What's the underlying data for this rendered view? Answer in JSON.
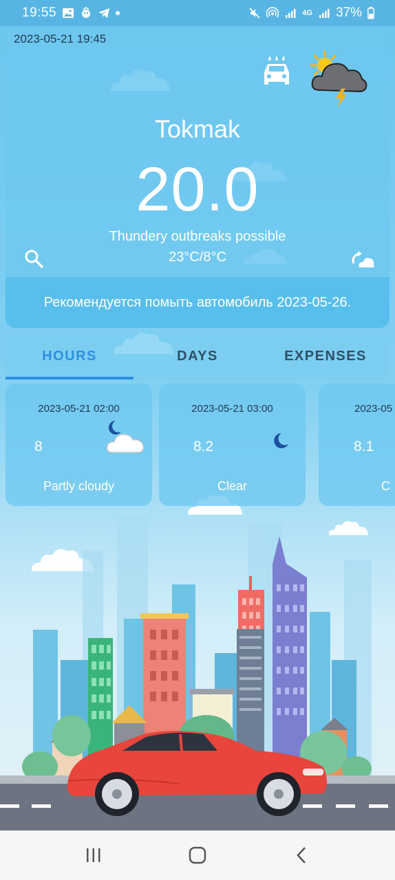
{
  "status_bar": {
    "time": "19:55",
    "network": "4G",
    "battery": "37%"
  },
  "main": {
    "timestamp": "2023-05-21 19:45",
    "city": "Tokmak",
    "temperature": "20.0",
    "condition": "Thundery outbreaks possible",
    "minmax": "23°C/8°C",
    "recommendation": "Рекомендуется помыть автомобиль 2023-05-26.",
    "weather_icon": "thunder-cloud-sun-icon",
    "car_wash_icon": "car-wash-icon"
  },
  "tabs": [
    {
      "label": "HOURS",
      "active": true
    },
    {
      "label": "DAYS",
      "active": false
    },
    {
      "label": "EXPENSES",
      "active": false
    }
  ],
  "hours": [
    {
      "time": "2023-05-21 02:00",
      "temp": "8",
      "desc": "Partly cloudy",
      "icon": "moon-cloud-icon"
    },
    {
      "time": "2023-05-21 03:00",
      "temp": "8.2",
      "desc": "Clear",
      "icon": "moon-icon"
    },
    {
      "time": "2023-05",
      "temp": "8.1",
      "desc": "C",
      "icon": "moon-icon"
    }
  ],
  "colors": {
    "accent": "#2e8fe0",
    "sky": "#6cc6ee",
    "card": "#6ec8f0",
    "car": "#e8453c"
  }
}
